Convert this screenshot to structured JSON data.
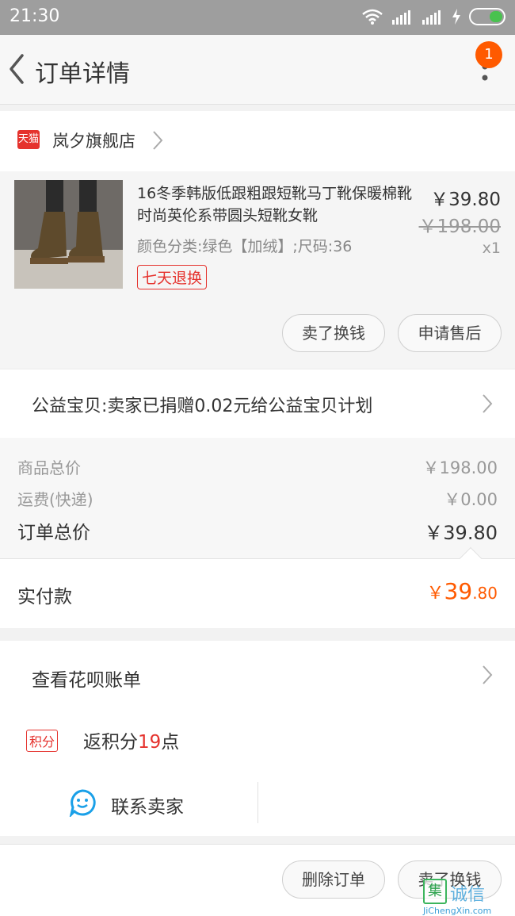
{
  "status_bar": {
    "time": "21:30"
  },
  "header": {
    "title": "订单详情",
    "badge_count": "1"
  },
  "store": {
    "logo_text": "天猫",
    "name": "岚夕旗舰店"
  },
  "product": {
    "title": "16冬季韩版低跟粗跟短靴马丁靴保暖棉靴时尚英伦系带圆头短靴女靴",
    "spec": "颜色分类:绿色【加绒】;尺码:36",
    "tag": "七天退换",
    "price_now": "￥39.80",
    "price_old": "￥198.00",
    "quantity": "x1",
    "buttons": {
      "sell": "卖了换钱",
      "after_sale": "申请售后"
    }
  },
  "charity": {
    "text": "公益宝贝:卖家已捐赠0.02元给公益宝贝计划"
  },
  "summary": {
    "goods_total_label": "商品总价",
    "goods_total_value": "￥198.00",
    "shipping_label": "运费(快递)",
    "shipping_value": "￥0.00",
    "order_total_label": "订单总价",
    "order_total_value": "￥39.80",
    "paid_label": "实付款",
    "paid_symbol": "￥",
    "paid_integer": "39",
    "paid_decimal": ".80"
  },
  "huabei": {
    "label": "查看花呗账单"
  },
  "points": {
    "tag": "积分",
    "prefix": "返积分",
    "number": "19",
    "suffix": "点"
  },
  "contact": {
    "label": "联系卖家"
  },
  "bottom_bar": {
    "delete_order": "删除订单",
    "sell": "卖了换钱"
  },
  "watermark": {
    "box_char": "集",
    "brand": "诚信",
    "url": "JiChengXin.com"
  },
  "colors": {
    "accent": "#ff5a00",
    "tmall_red": "#e5322d",
    "contact_blue": "#1aa0e8"
  }
}
